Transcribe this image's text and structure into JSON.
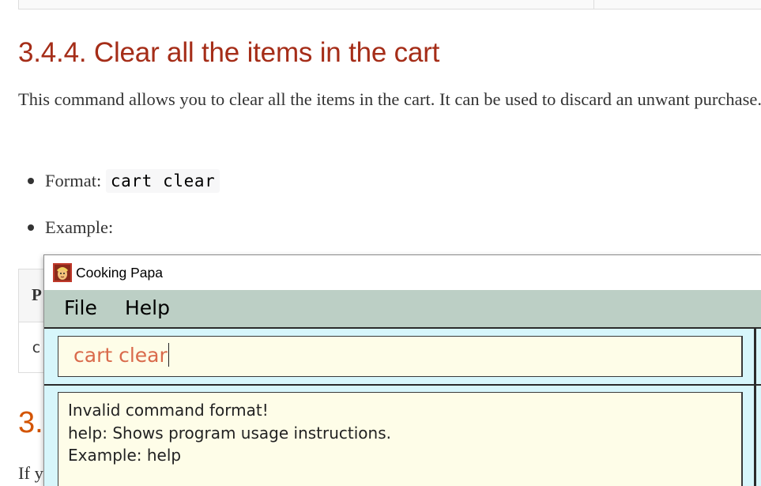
{
  "doc": {
    "section_title": "3.4.4. Clear all the items in the cart",
    "description": "This command allows you to clear all the items in the cart. It can be used to discard an unwant purchase.",
    "format_label": "Format:",
    "format_code": "cart clear",
    "example_label": "Example:",
    "table_header_partial": "P",
    "table_cell_partial": "c",
    "next_section_partial": "3.",
    "next_paragraph_partial": "If y",
    "title_color": "#a52d18"
  },
  "app": {
    "window_title": "Cooking Papa",
    "icon": "cooking-papa-app-icon",
    "menu": {
      "file_label": "File",
      "help_label": "Help"
    },
    "command_box": {
      "value": "cart clear"
    },
    "result": {
      "lines": [
        "Invalid command format!",
        "help: Shows program usage instructions.",
        "Example: help"
      ]
    },
    "colors": {
      "menubar": "#bccfc5",
      "panel": "#d7f6fb",
      "box": "#fefde8",
      "command_text": "#d96a4b"
    }
  }
}
